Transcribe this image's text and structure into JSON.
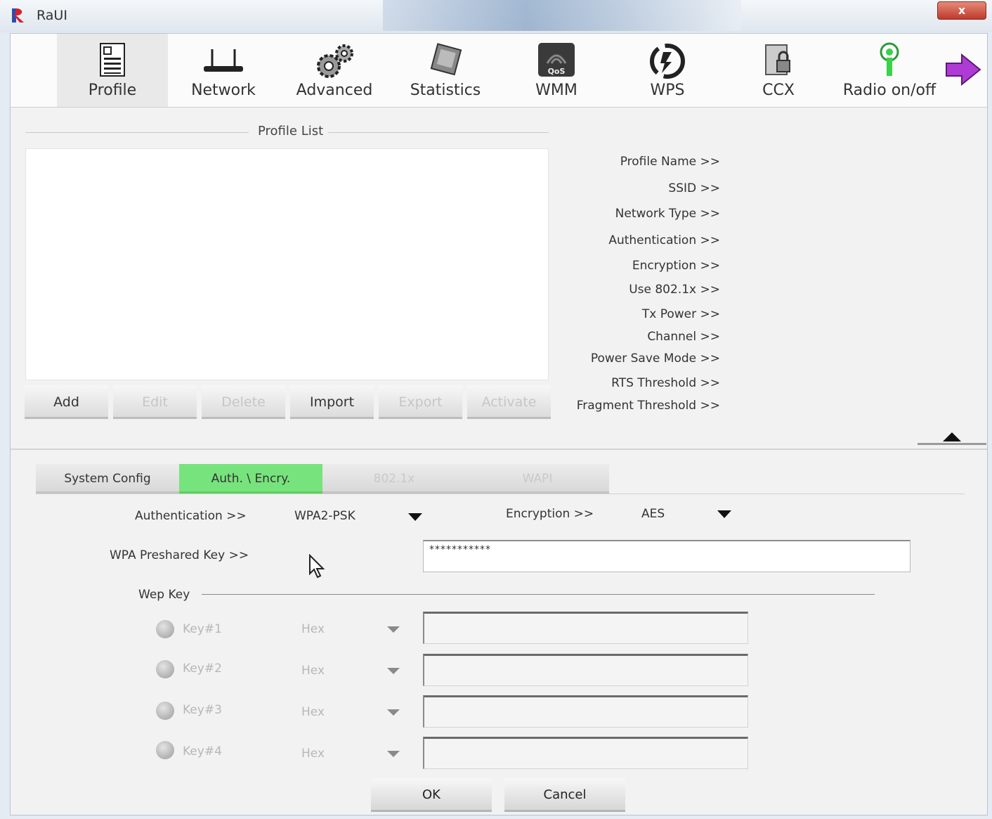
{
  "window": {
    "title": "RaUI",
    "close_label": "x"
  },
  "toolbar": {
    "items": [
      {
        "label": "Profile",
        "icon": "profile-icon",
        "active": true
      },
      {
        "label": "Network",
        "icon": "router-icon"
      },
      {
        "label": "Advanced",
        "icon": "gears-icon"
      },
      {
        "label": "Statistics",
        "icon": "chip-icon"
      },
      {
        "label": "WMM",
        "icon": "qos-icon"
      },
      {
        "label": "WPS",
        "icon": "wps-icon"
      },
      {
        "label": "CCX",
        "icon": "lock-card-icon"
      },
      {
        "label": "Radio on/off",
        "icon": "radio-antenna-icon"
      }
    ],
    "next_icon": "right-arrow-icon"
  },
  "profile_list": {
    "title": "Profile List",
    "buttons": [
      {
        "label": "Add",
        "enabled": true
      },
      {
        "label": "Edit",
        "enabled": false
      },
      {
        "label": "Delete",
        "enabled": false
      },
      {
        "label": "Import",
        "enabled": true
      },
      {
        "label": "Export",
        "enabled": false
      },
      {
        "label": "Activate",
        "enabled": false
      }
    ]
  },
  "profile_info": {
    "labels": [
      "Profile Name >>",
      "SSID >>",
      "Network Type >>",
      "Authentication >>",
      "Encryption >>",
      "Use 802.1x >>",
      "Tx Power >>",
      "Channel >>",
      "Power Save Mode >>",
      "RTS Threshold >>",
      "Fragment Threshold >>"
    ]
  },
  "tabs": [
    {
      "label": "System Config",
      "state": "normal"
    },
    {
      "label": "Auth. \\ Encry.",
      "state": "active"
    },
    {
      "label": "802.1x",
      "state": "disabled"
    },
    {
      "label": "WAPI",
      "state": "disabled"
    }
  ],
  "auth": {
    "authentication_label": "Authentication >>",
    "authentication_value": "WPA2-PSK",
    "encryption_label": "Encryption >>",
    "encryption_value": "AES",
    "psk_label": "WPA Preshared Key >>",
    "psk_value": "***********"
  },
  "wep": {
    "title": "Wep Key",
    "keys": [
      {
        "label": "Key#1",
        "format": "Hex"
      },
      {
        "label": "Key#2",
        "format": "Hex"
      },
      {
        "label": "Key#3",
        "format": "Hex"
      },
      {
        "label": "Key#4",
        "format": "Hex"
      }
    ]
  },
  "footer": {
    "ok_label": "OK",
    "cancel_label": "Cancel"
  },
  "colors": {
    "active_tab": "#77e37c",
    "close_button": "#c0392b",
    "next_arrow": "#b03ad6"
  }
}
